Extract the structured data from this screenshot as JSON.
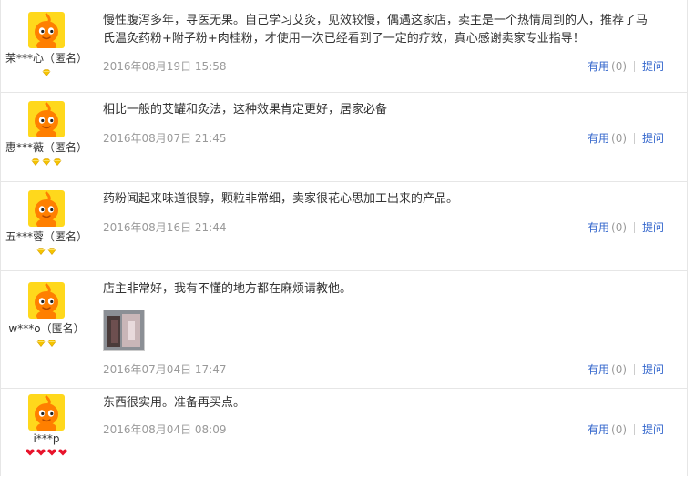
{
  "reviews": [
    {
      "user": "茉***心（匿名）",
      "content": "慢性腹泻多年，寻医无果。自己学习艾灸，见效较慢，偶遇这家店，卖主是一个热情周到的人，推荐了马氏温灸药粉+附子粉+肉桂粉，才使用一次已经看到了一定的疗效，真心感谢卖家专业指导！",
      "date": "2016年08月19日 15:58",
      "useful": "有用",
      "count": "(0)",
      "ask": "提问",
      "rank": "gold",
      "rank_count": 1
    },
    {
      "user": "惠***薇（匿名）",
      "content": "相比一般的艾罐和灸法，这种效果肯定更好，居家必备",
      "date": "2016年08月07日 21:45",
      "useful": "有用",
      "count": "(0)",
      "ask": "提问",
      "rank": "gold",
      "rank_count": 3
    },
    {
      "user": "五***蓉（匿名）",
      "content": "药粉闻起来味道很醇，颗粒非常细，卖家很花心思加工出来的产品。",
      "date": "2016年08月16日 21:44",
      "useful": "有用",
      "count": "(0)",
      "ask": "提问",
      "rank": "gold",
      "rank_count": 2
    },
    {
      "user": "w***o（匿名）",
      "content": "店主非常好，我有不懂的地方都在麻烦请教他。",
      "date": "2016年07月04日 17:47",
      "useful": "有用",
      "count": "(0)",
      "ask": "提问",
      "rank": "gold",
      "rank_count": 2,
      "has_photo": true
    },
    {
      "user": "i***p",
      "content": "东西很实用。准备再买点。",
      "date": "2016年08月04日 08:09",
      "useful": "有用",
      "count": "(0)",
      "ask": "提问",
      "rank": "red",
      "rank_count": 4
    }
  ],
  "colors": {
    "link": "#3366cc",
    "date": "#9a9a9a",
    "gold_gem": "#f5c400",
    "red_gem": "#e8132b",
    "avatar_bg": "#ffd81c",
    "avatar_face": "#ff7f00"
  },
  "icons": {
    "avatar": "orange-mascot-avatar",
    "gold": "gold-diamond-icon",
    "red": "red-heart-gem-icon"
  }
}
